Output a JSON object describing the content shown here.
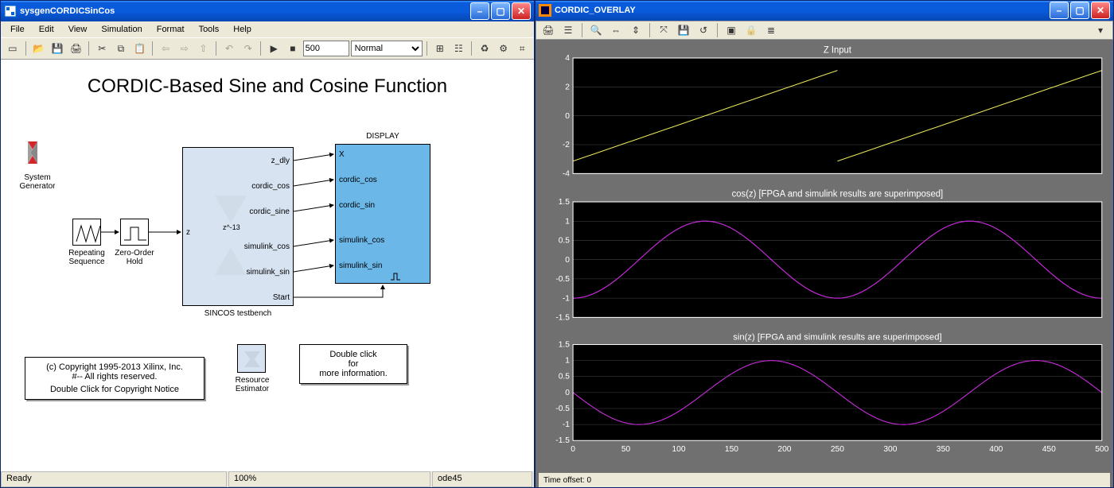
{
  "leftWindow": {
    "title": "sysgenCORDICSinCos",
    "menus": [
      "File",
      "Edit",
      "View",
      "Simulation",
      "Format",
      "Tools",
      "Help"
    ],
    "toolbar": {
      "stop_time": "500",
      "mode": "Normal"
    },
    "modelTitle": "CORDIC-Based Sine and Cosine Function",
    "sysgenLabel": "System\nGenerator",
    "repeatLabel": "Repeating\nSequence",
    "zohLabel": "Zero-Order\nHold",
    "sincosLabel": "SINCOS testbench",
    "resEstLabel": "Resource\nEstimator",
    "displayTitle": "DISPLAY",
    "sincosOutPorts": [
      "z_dly",
      "cordic_cos",
      "cordic_sine",
      "simulink_cos",
      "simulink_sin",
      "Start"
    ],
    "sincosInPort": "z",
    "sincosInner": "z^-13",
    "displayInPorts": [
      "X",
      "cordic_cos",
      "cordic_sin",
      "simulink_cos",
      "simulink_sin"
    ],
    "copyright": [
      "(c) Copyright 1995-2013 Xilinx, Inc.",
      "#-- All rights reserved.",
      "Double Click for Copyright Notice"
    ],
    "info": [
      "Double click",
      "for",
      "more information."
    ],
    "status": {
      "ready": "Ready",
      "zoom": "100%",
      "solver": "ode45"
    }
  },
  "rightWindow": {
    "title": "CORDIC_OVERLAY",
    "footer": "Time offset:   0",
    "plotTitles": [
      "Z Input",
      "cos(z)     [FPGA and simulink results are superimposed]",
      "sin(z)     [FPGA and simulink results are superimposed]"
    ]
  },
  "chart_data": [
    {
      "type": "line",
      "title": "Z Input",
      "xlabel": "",
      "ylabel": "",
      "xlim": [
        0,
        500
      ],
      "ylim": [
        -4,
        4
      ],
      "yticks": [
        -4,
        -2,
        0,
        2,
        4
      ],
      "series": [
        {
          "name": "z",
          "segments": [
            {
              "x": [
                0,
                250
              ],
              "y": [
                -3.14,
                3.14
              ]
            },
            {
              "x": [
                250,
                500
              ],
              "y": [
                -3.14,
                3.14
              ]
            }
          ],
          "color": "#e8e85a"
        }
      ]
    },
    {
      "type": "line",
      "title": "cos(z)     [FPGA and simulink results are superimposed]",
      "xlabel": "",
      "ylabel": "",
      "xlim": [
        0,
        500
      ],
      "ylim": [
        -1.5,
        1.5
      ],
      "yticks": [
        -1.5,
        -1,
        -0.5,
        0,
        0.5,
        1,
        1.5
      ],
      "series": [
        {
          "name": "cordic_cos",
          "func": "-cos",
          "periods": 2,
          "color": "#d946ef"
        },
        {
          "name": "simulink_cos",
          "func": "-cos",
          "periods": 2,
          "color": "#c026d3"
        }
      ]
    },
    {
      "type": "line",
      "title": "sin(z)     [FPGA and simulink results are superimposed]",
      "xlabel": "",
      "ylabel": "",
      "xlim": [
        0,
        500
      ],
      "ylim": [
        -1.5,
        1.5
      ],
      "yticks": [
        -1.5,
        -1,
        -0.5,
        0,
        0.5,
        1,
        1.5
      ],
      "xticks": [
        0,
        50,
        100,
        150,
        200,
        250,
        300,
        350,
        400,
        450,
        500
      ],
      "series": [
        {
          "name": "cordic_sin",
          "func": "-sin",
          "periods": 2,
          "color": "#d946ef"
        },
        {
          "name": "simulink_sin",
          "func": "-sin",
          "periods": 2,
          "color": "#c026d3"
        }
      ]
    }
  ]
}
